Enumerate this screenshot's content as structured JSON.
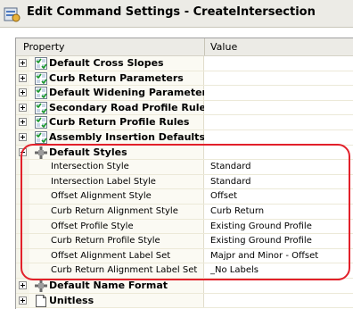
{
  "window": {
    "title": "Edit Command Settings - CreateIntersection"
  },
  "columns": {
    "property": "Property",
    "value": "Value"
  },
  "rows": [
    {
      "label": "Default Cross Slopes",
      "type": "group",
      "expanded": false,
      "icon": "check-grid-icon"
    },
    {
      "label": "Curb Return Parameters",
      "type": "group",
      "expanded": false,
      "icon": "check-grid-icon"
    },
    {
      "label": "Default Widening Parameters",
      "type": "group",
      "expanded": false,
      "icon": "check-grid-icon"
    },
    {
      "label": "Secondary Road Profile Rules",
      "type": "group",
      "expanded": false,
      "icon": "check-grid-icon"
    },
    {
      "label": "Curb Return Profile Rules",
      "type": "group",
      "expanded": false,
      "icon": "check-grid-icon"
    },
    {
      "label": "Assembly Insertion Defaults",
      "type": "group",
      "expanded": false,
      "icon": "check-grid-icon"
    },
    {
      "label": "Default Styles",
      "type": "group",
      "expanded": true,
      "icon": "styles-cross-icon"
    },
    {
      "label": "Intersection Style",
      "type": "child",
      "value": "Standard"
    },
    {
      "label": "Intersection Label Style",
      "type": "child",
      "value": "Standard"
    },
    {
      "label": "Offset Alignment Style",
      "type": "child",
      "value": "Offset"
    },
    {
      "label": "Curb Return Alignment Style",
      "type": "child",
      "value": "Curb Return"
    },
    {
      "label": "Offset Profile Style",
      "type": "child",
      "value": "Existing Ground Profile"
    },
    {
      "label": "Curb Return Profile Style",
      "type": "child",
      "value": "Existing Ground Profile"
    },
    {
      "label": "Offset Alignment Label Set",
      "type": "child",
      "value": "Majpr and Minor - Offset"
    },
    {
      "label": "Curb Return Alignment Label Set",
      "type": "child",
      "value": "_No Labels"
    },
    {
      "label": "Default Name Format",
      "type": "group",
      "expanded": false,
      "icon": "styles-cross-icon"
    },
    {
      "label": "Unitless",
      "type": "group",
      "expanded": false,
      "icon": "document-icon"
    }
  ],
  "colors": {
    "highlight": "#e2202a",
    "title_bg": "#ecebe6"
  }
}
